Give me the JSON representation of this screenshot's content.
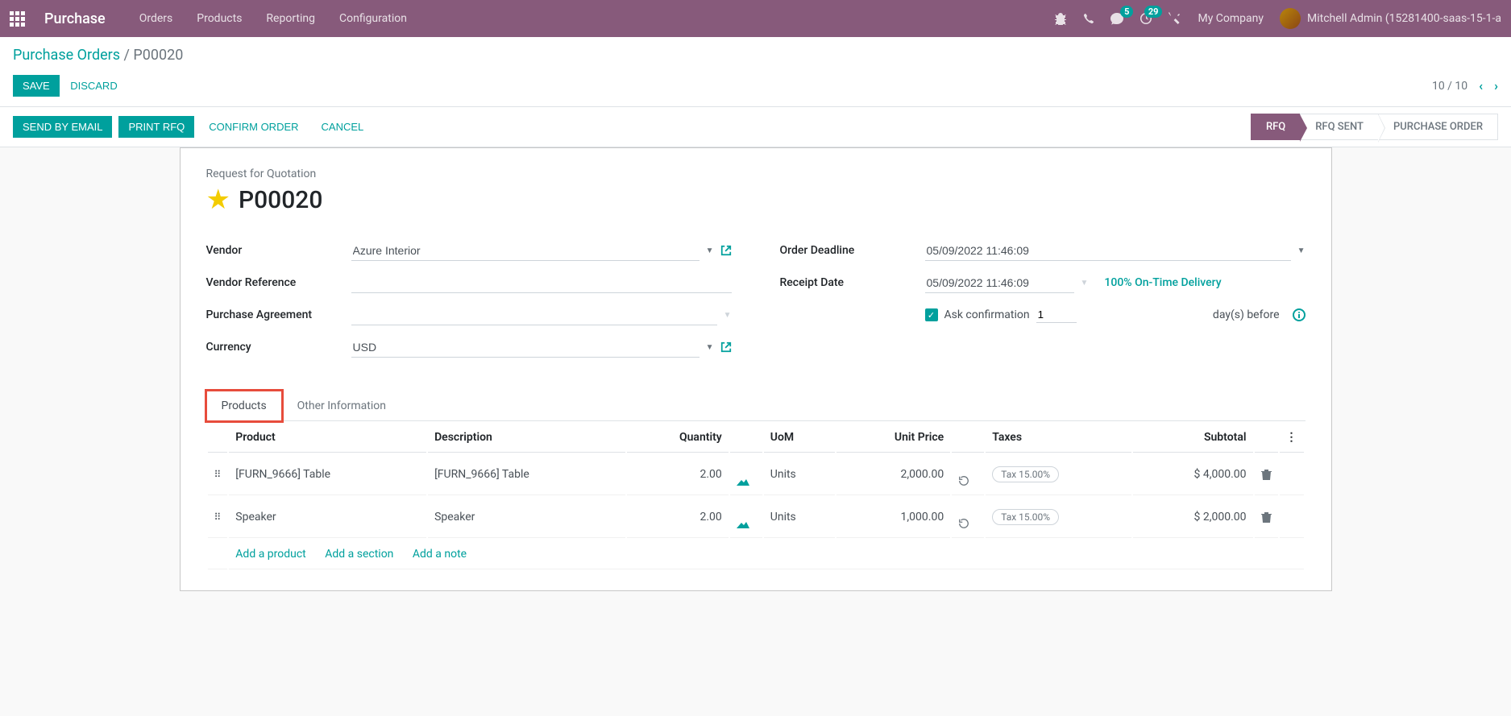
{
  "navbar": {
    "app_name": "Purchase",
    "menu": [
      "Orders",
      "Products",
      "Reporting",
      "Configuration"
    ],
    "messages_badge": "5",
    "activities_badge": "29",
    "company": "My Company",
    "user": "Mitchell Admin (15281400-saas-15-1-a"
  },
  "breadcrumb": {
    "parent": "Purchase Orders",
    "current": "P00020"
  },
  "buttons": {
    "save": "SAVE",
    "discard": "DISCARD",
    "send_email": "SEND BY EMAIL",
    "print_rfq": "PRINT RFQ",
    "confirm": "CONFIRM ORDER",
    "cancel": "CANCEL"
  },
  "pager": {
    "text": "10 / 10"
  },
  "status": {
    "steps": [
      "RFQ",
      "RFQ SENT",
      "PURCHASE ORDER"
    ],
    "active": 0
  },
  "form": {
    "title_label": "Request for Quotation",
    "title": "P00020",
    "labels": {
      "vendor": "Vendor",
      "vendor_ref": "Vendor Reference",
      "purchase_agreement": "Purchase Agreement",
      "currency": "Currency",
      "order_deadline": "Order Deadline",
      "receipt_date": "Receipt Date",
      "ask_confirmation": "Ask confirmation",
      "days_before": "day(s) before"
    },
    "values": {
      "vendor": "Azure Interior",
      "vendor_ref": "",
      "purchase_agreement": "",
      "currency": "USD",
      "order_deadline": "05/09/2022 11:46:09",
      "receipt_date": "05/09/2022 11:46:09",
      "on_time": "100% On-Time Delivery",
      "confirmation_days": "1"
    }
  },
  "tabs": [
    "Products",
    "Other Information"
  ],
  "table": {
    "headers": {
      "product": "Product",
      "description": "Description",
      "quantity": "Quantity",
      "uom": "UoM",
      "unit_price": "Unit Price",
      "taxes": "Taxes",
      "subtotal": "Subtotal"
    },
    "rows": [
      {
        "product": "[FURN_9666] Table",
        "description": "[FURN_9666] Table",
        "quantity": "2.00",
        "uom": "Units",
        "unit_price": "2,000.00",
        "tax": "Tax 15.00%",
        "subtotal": "$ 4,000.00"
      },
      {
        "product": "Speaker",
        "description": "Speaker",
        "quantity": "2.00",
        "uom": "Units",
        "unit_price": "1,000.00",
        "tax": "Tax 15.00%",
        "subtotal": "$ 2,000.00"
      }
    ],
    "add_product": "Add a product",
    "add_section": "Add a section",
    "add_note": "Add a note"
  }
}
